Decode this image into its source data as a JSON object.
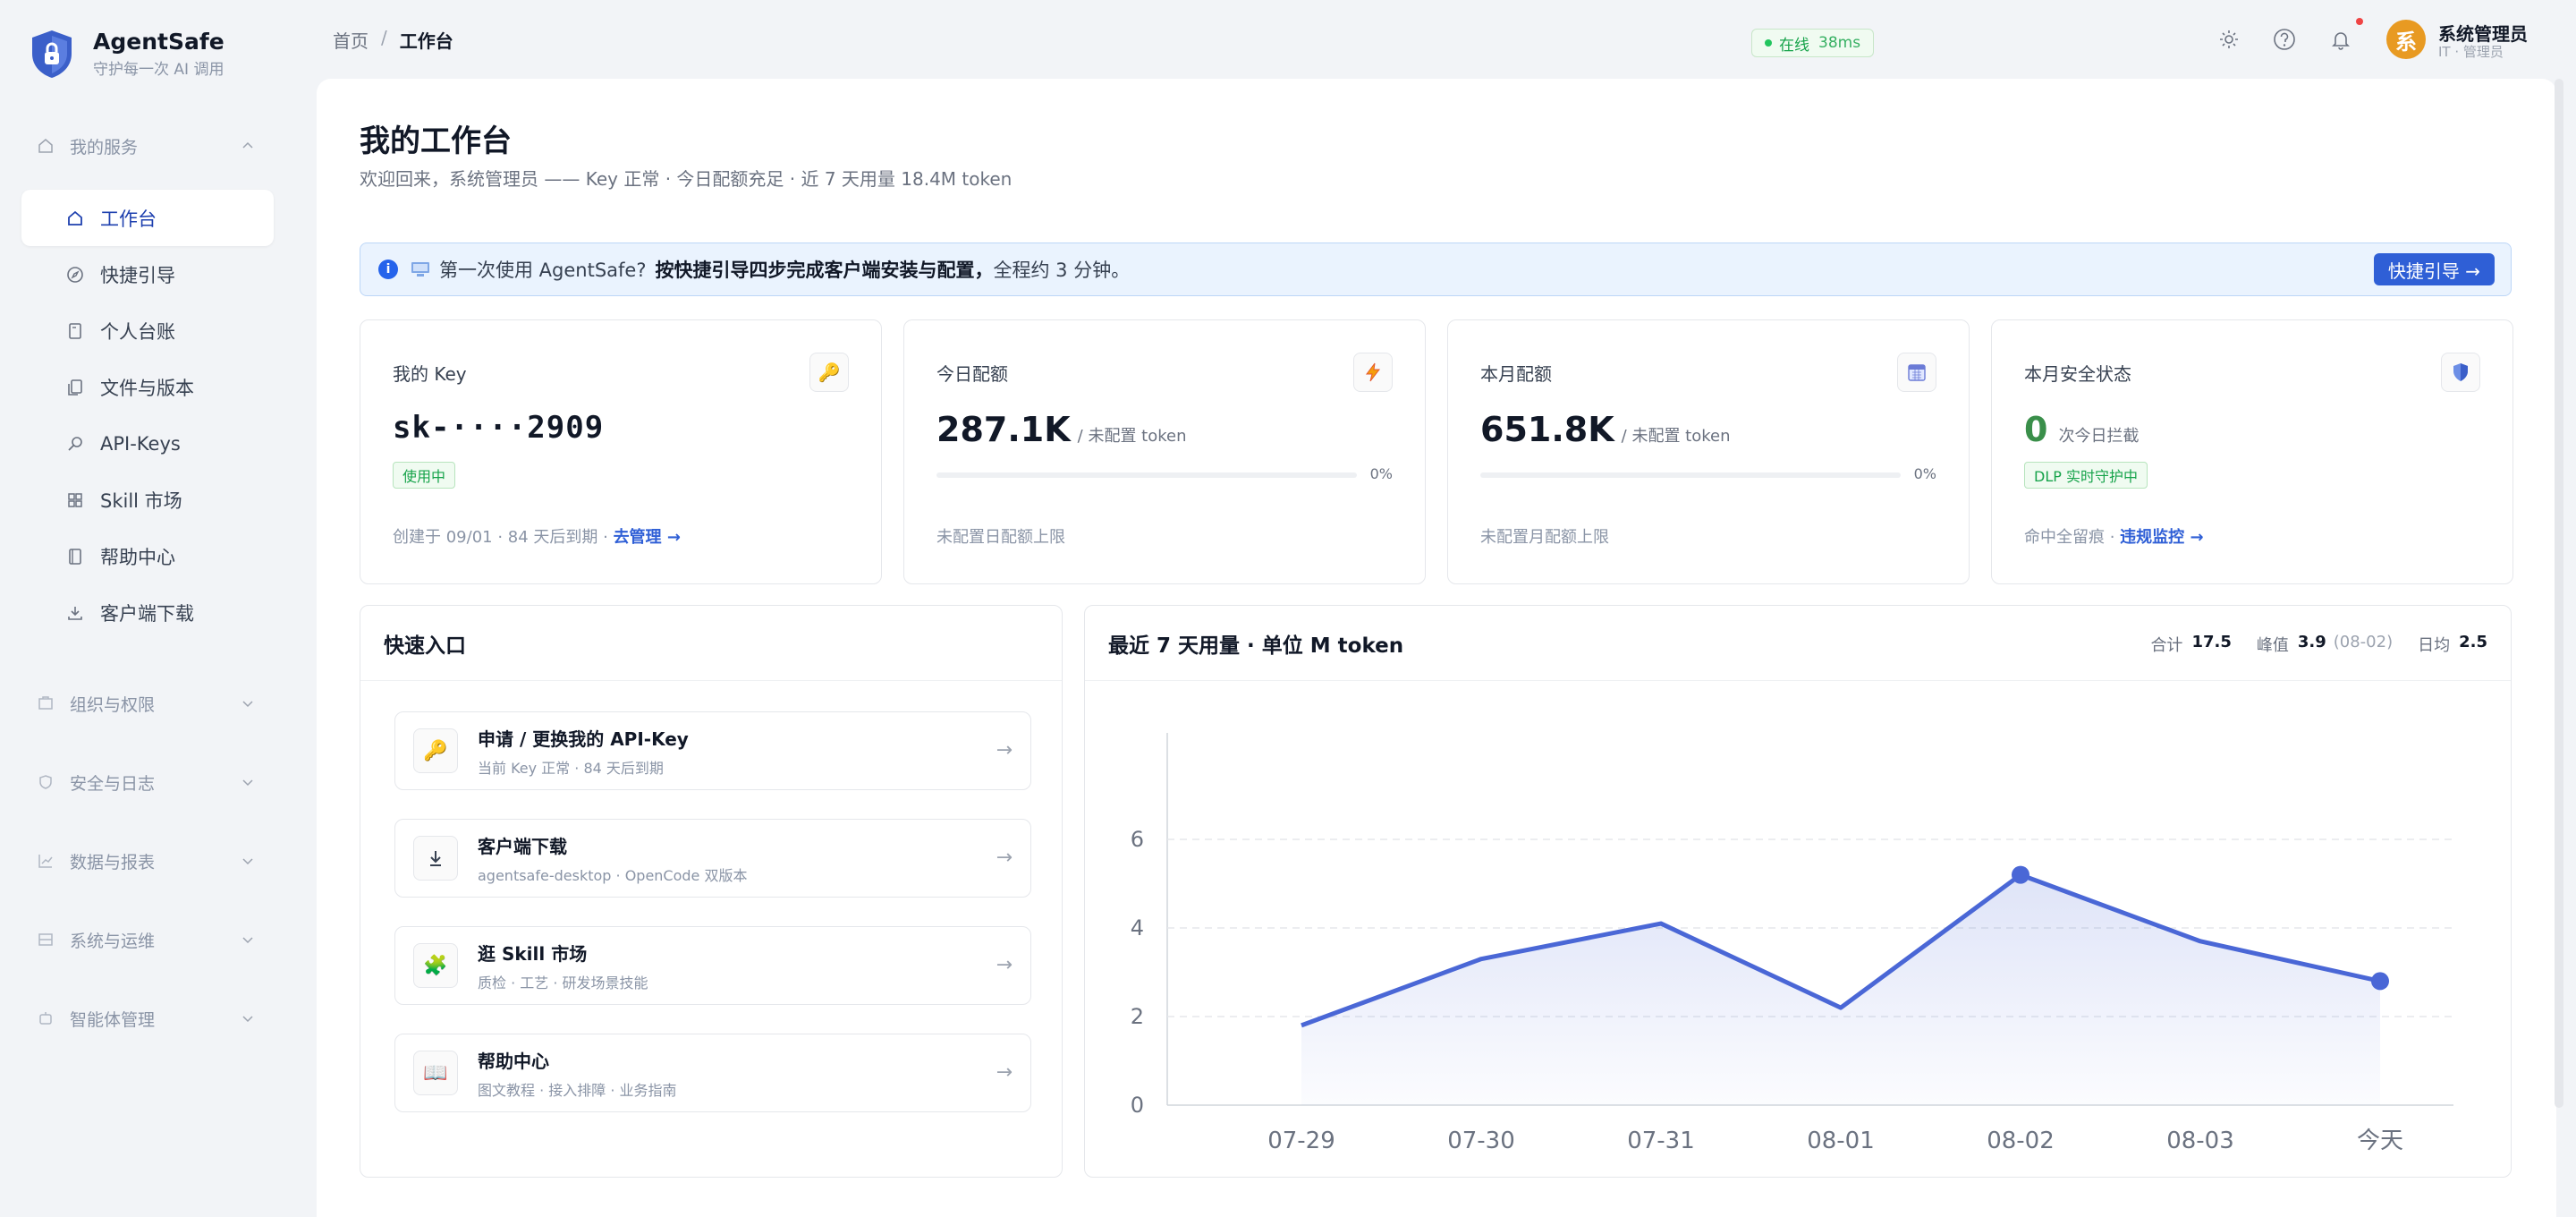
{
  "brand": {
    "name": "AgentSafe",
    "slogan": "守护每一次 AI 调用"
  },
  "sidebar": {
    "groups": [
      {
        "label": "我的服务",
        "icon": "home-icon",
        "expanded": true,
        "items": [
          {
            "label": "工作台",
            "icon": "home-icon",
            "active": true
          },
          {
            "label": "快捷引导",
            "icon": "compass-icon"
          },
          {
            "label": "个人台账",
            "icon": "document-icon"
          },
          {
            "label": "文件与版本",
            "icon": "files-icon"
          },
          {
            "label": "API-Keys",
            "icon": "key-icon"
          },
          {
            "label": "Skill 市场",
            "icon": "grid-icon"
          },
          {
            "label": "帮助中心",
            "icon": "book-icon"
          },
          {
            "label": "客户端下载",
            "icon": "download-icon"
          }
        ]
      },
      {
        "label": "组织与权限",
        "icon": "org-icon",
        "expanded": false
      },
      {
        "label": "安全与日志",
        "icon": "shield-icon",
        "expanded": false
      },
      {
        "label": "数据与报表",
        "icon": "chart-icon",
        "expanded": false
      },
      {
        "label": "系统与运维",
        "icon": "server-icon",
        "expanded": false
      },
      {
        "label": "智能体管理",
        "icon": "agent-icon",
        "expanded": false
      }
    ]
  },
  "header": {
    "breadcrumb": [
      "首页",
      "工作台"
    ],
    "status": {
      "label": "在线",
      "latency": "38ms",
      "color": "#22c55e"
    },
    "user": {
      "avatar_char": "系",
      "name": "系统管理员",
      "role": "IT · 管理员",
      "avatar_color": "#e89a22"
    },
    "icons": [
      "sun-icon",
      "help-icon",
      "bell-icon"
    ]
  },
  "page": {
    "title": "我的工作台",
    "subtitle": "欢迎回来，系统管理员 —— Key 正常 · 今日配额充足 · 近 7 天用量 18.4M token"
  },
  "banner": {
    "prefix": "第一次使用 AgentSafe?",
    "bold": "按快捷引导四步完成客户端安装与配置，",
    "suffix": "全程约 3 分钟。",
    "button": "快捷引导 →"
  },
  "cards": {
    "key": {
      "title": "我的 Key",
      "icon": "key-icon",
      "value": "sk-····2909",
      "tag": "使用中",
      "foot": "创建于 09/01 · 84 天后到期 · ",
      "link": "去管理 →"
    },
    "daily": {
      "title": "今日配额",
      "icon": "bolt-icon",
      "value": "287.1K",
      "unit": "/ 未配置 token",
      "percent": 0,
      "percent_label": "0%",
      "foot": "未配置日配额上限"
    },
    "monthly": {
      "title": "本月配额",
      "icon": "calendar-icon",
      "value": "651.8K",
      "unit": "/ 未配置 token",
      "percent": 0,
      "percent_label": "0%",
      "foot": "未配置月配额上限"
    },
    "security": {
      "title": "本月安全状态",
      "icon": "shield-icon",
      "value": "0",
      "unit": "次今日拦截",
      "tag": "DLP 实时守护中",
      "foot": "命中全留痕 · ",
      "link": "违规监控 →"
    }
  },
  "quick": {
    "title": "快速入口",
    "items": [
      {
        "icon": "key-icon",
        "title": "申请 / 更换我的 API-Key",
        "sub": "当前 Key 正常 · 84 天后到期",
        "arrow": "→"
      },
      {
        "icon": "download-icon",
        "title": "客户端下载",
        "sub": "agentsafe-desktop · OpenCode 双版本",
        "arrow": "→"
      },
      {
        "icon": "puzzle-icon",
        "title": "逛 Skill 市场",
        "sub": "质检 · 工艺 · 研发场景技能",
        "arrow": "→"
      },
      {
        "icon": "book-icon",
        "title": "帮助中心",
        "sub": "图文教程 · 接入排障 · 业务指南",
        "arrow": "→"
      }
    ]
  },
  "usage": {
    "title": "最近 7 天用量 · 单位 M token",
    "stats": {
      "total_label": "合计",
      "total": "17.5",
      "peak_label": "峰值",
      "peak": "3.9",
      "peak_note": "(08-02)",
      "avg_label": "日均",
      "avg": "2.5"
    }
  },
  "chart_data": {
    "type": "area",
    "categories": [
      "07-29",
      "07-30",
      "07-31",
      "08-01",
      "08-02",
      "08-03",
      "今天"
    ],
    "values": [
      1.8,
      3.3,
      4.1,
      2.2,
      5.2,
      3.7,
      2.8
    ],
    "ylim": [
      0,
      8
    ],
    "yticks": [
      0,
      2,
      4,
      6
    ],
    "grid": true,
    "color": "#4a67d6",
    "highlight_points": [
      4,
      6
    ]
  },
  "colors": {
    "accent": "#2f5fd6",
    "success": "#16a34a",
    "chart_line": "#4a67d6"
  }
}
